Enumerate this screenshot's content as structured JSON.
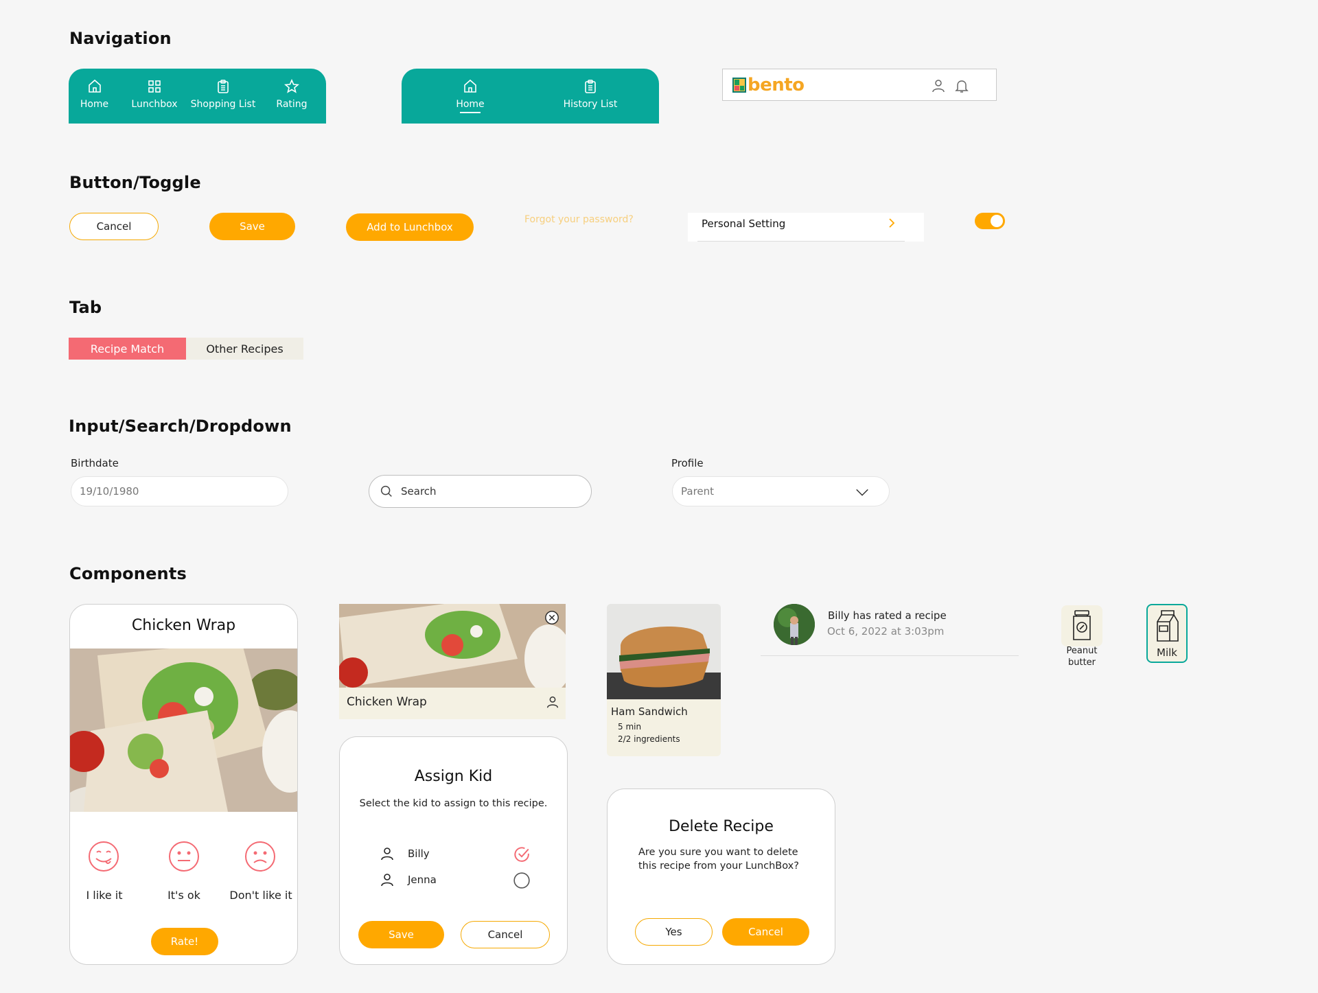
{
  "sections": {
    "navigation": "Navigation",
    "buttons": "Button/Toggle",
    "tab": "Tab",
    "inputs": "Input/Search/Dropdown",
    "components": "Components"
  },
  "nav_bar_1": {
    "items": [
      {
        "label": "Home",
        "icon": "home-icon"
      },
      {
        "label": "Lunchbox",
        "icon": "grid-icon"
      },
      {
        "label": "Shopping List",
        "icon": "clipboard-icon"
      },
      {
        "label": "Rating",
        "icon": "star-icon"
      }
    ]
  },
  "nav_bar_2": {
    "items": [
      {
        "label": "Home",
        "icon": "home-icon",
        "active": true
      },
      {
        "label": "History List",
        "icon": "clipboard-icon"
      }
    ]
  },
  "header_bar": {
    "logo_text": "bento",
    "icons": [
      "user-icon",
      "bell-icon"
    ]
  },
  "buttons": {
    "cancel": "Cancel",
    "save": "Save",
    "add_to_lunchbox": "Add to Lunchbox",
    "forgot_password": "Forgot your password?",
    "personal_setting": "Personal Setting",
    "toggle_on": true
  },
  "tabs": {
    "active": "Recipe Match",
    "inactive": "Other Recipes"
  },
  "inputs": {
    "birthdate_label": "Birthdate",
    "birthdate_value": "19/10/1980",
    "search_placeholder": "Search",
    "profile_label": "Profile",
    "profile_value": "Parent"
  },
  "rating_card": {
    "title": "Chicken Wrap",
    "options": [
      "I like it",
      "It's ok",
      "Don't like it"
    ],
    "rate_button": "Rate!"
  },
  "recipe_card_small": {
    "title": "Chicken Wrap",
    "close_label": "X"
  },
  "assign_kid": {
    "title": "Assign Kid",
    "subtitle": "Select the kid to assign to this recipe.",
    "kids": [
      {
        "name": "Billy",
        "checked": true
      },
      {
        "name": "Jenna",
        "checked": false
      }
    ],
    "save": "Save",
    "cancel": "Cancel"
  },
  "ham_card": {
    "title": "Ham Sandwich",
    "time": "5 min",
    "ingredients": "2/2 ingredients"
  },
  "delete_recipe": {
    "title": "Delete Recipe",
    "message_line1": "Are you sure you want to delete",
    "message_line2": "this recipe from your LunchBox?",
    "yes": "Yes",
    "cancel": "Cancel"
  },
  "notification": {
    "text": "Billy has rated a recipe",
    "time": "Oct 6, 2022 at 3:03pm"
  },
  "ingredients": [
    {
      "line1": "Peanut",
      "line2": "butter",
      "icon": "jar-icon",
      "selected": false
    },
    {
      "label": "Milk",
      "icon": "milk-carton-icon",
      "selected": true
    }
  ],
  "colors": {
    "teal": "#08a89a",
    "orange": "#ffa800",
    "coral": "#f46a73",
    "cream": "#f4f1e3"
  }
}
